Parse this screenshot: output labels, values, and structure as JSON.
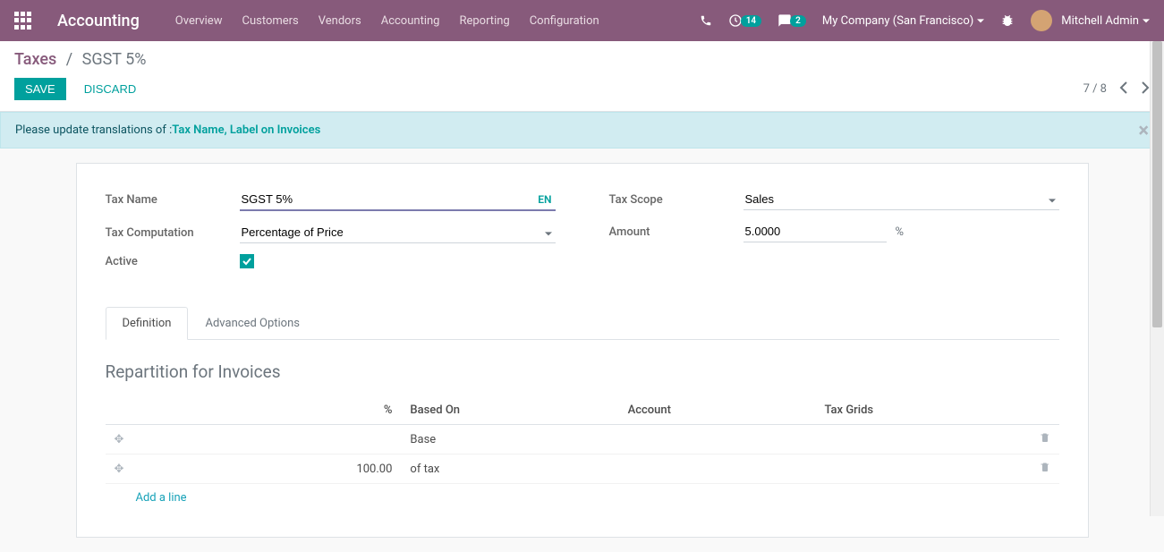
{
  "topnav": {
    "brand": "Accounting",
    "menu": [
      "Overview",
      "Customers",
      "Vendors",
      "Accounting",
      "Reporting",
      "Configuration"
    ],
    "activities_count": "14",
    "messages_count": "2",
    "company_name": "My Company (San Francisco)",
    "user_name": "Mitchell Admin"
  },
  "breadcrumb": {
    "parent": "Taxes",
    "current": "SGST 5%"
  },
  "buttons": {
    "save": "SAVE",
    "discard": "DISCARD"
  },
  "pager": {
    "text": "7 / 8"
  },
  "alert": {
    "prefix": "Please update translations of : ",
    "link": "Tax Name, Label on Invoices"
  },
  "form": {
    "labels": {
      "tax_name": "Tax Name",
      "tax_computation": "Tax Computation",
      "active": "Active",
      "tax_scope": "Tax Scope",
      "amount": "Amount"
    },
    "values": {
      "tax_name": "SGST 5%",
      "lang": "EN",
      "tax_computation": "Percentage of Price",
      "tax_scope": "Sales",
      "amount": "5.0000",
      "pct_sign": "%"
    }
  },
  "tabs": {
    "def": "Definition",
    "adv": "Advanced Options"
  },
  "repartition": {
    "title": "Repartition for Invoices",
    "headers": {
      "pct": "%",
      "based_on": "Based On",
      "account": "Account",
      "tax_grids": "Tax Grids"
    },
    "rows": [
      {
        "pct": "",
        "based_on": "Base"
      },
      {
        "pct": "100.00",
        "based_on": "of tax"
      }
    ],
    "add_line": "Add a line"
  }
}
